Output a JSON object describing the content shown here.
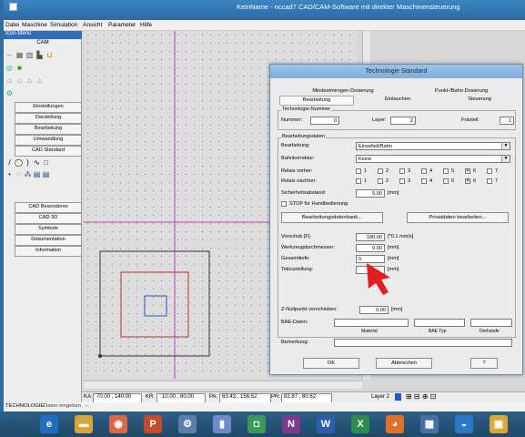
{
  "window": {
    "title": "KeinName - nccad7  CAD/CAM-Software mit direkter Maschinensteuerung"
  },
  "menu": [
    "Datei",
    "Maschine",
    "Simulation",
    "Ansicht",
    "Parameter",
    "Hilfe"
  ],
  "left": {
    "iconmenu_label": "Icon-Menü",
    "cam_label": "CAM",
    "buttons": [
      "Einstellungen",
      "Darstellung",
      "Bearbeitung",
      "Umwandlung",
      "CAD Standard"
    ],
    "buttons2": [
      "CAD Besonderes",
      "CAD 3D",
      "Symbole",
      "Dokumentation",
      "Information"
    ]
  },
  "status": {
    "ka_label": "KA:",
    "ka_value": "70.00 , 140.00",
    "kr_label": "KR:",
    "kr_value": "10.00 , 80.00",
    "pa_label": "PA:",
    "pa_value": "63.43 , 156.52",
    "pr_label": "PR:",
    "pr_value": "82.87 , 80.62",
    "layer": "Layer 2"
  },
  "cmdbar": {
    "mode": "TECHNOLOGIE",
    "prompt": "Daten eingeben"
  },
  "dialog": {
    "title": "Technologie Standard",
    "tabs_row1": [
      "Mindestmengen-Dosierung",
      "Punkt-/Bahn-Dosierung"
    ],
    "tabs_row2": [
      "Bearbeitung",
      "Eintauchen",
      "Steuerung"
    ],
    "tech_group": "Technologie-Nummer",
    "nummer_label": "Nummer:",
    "nummer_value": "0",
    "layer_label": "Layer:",
    "layer_value": "2",
    "fraeser_label": "Frästeil:",
    "fraeser_value": "1",
    "data_group": "Bearbeitungsdaten",
    "bearbeitung_label": "Bearbeitung:",
    "bearbeitung_value": "Einzelteil/Bahn",
    "bahnkorrektur_label": "Bahnkorrektur:",
    "bahnkorrektur_value": "Keine",
    "relais_vorher_label": "Relais vorher:",
    "relais_nachher_label": "Relais nachher:",
    "relais_options": [
      "1",
      "2",
      "3",
      "4",
      "5",
      "6",
      "7"
    ],
    "relais_checked": "6",
    "sicherheit_label": "Sicherheitsabstand:",
    "sicherheit_value": "5.00",
    "unit_mm": "[mm]",
    "stop_label": "STOP für Handbedienung",
    "btn_db": "Bearbeitungsdatenbank...",
    "btn_private": "Privatdaten bearbeiten...",
    "vorschub_label": "Vorschub [F]:",
    "vorschub_value": "180.00",
    "vorschub_unit": "[*0.1 mm/s]",
    "werkzeug_label": "Werkzeugdurchmesser:",
    "werkzeug_value": "0.00",
    "gesamttiefe_label": "Gesamttiefe:",
    "gesamttiefe_value": "0.",
    "teilzustellung_label": "Teilzustellung:",
    "teilzustellung_value": "",
    "znull_label": "Z-Nullpunkt verschieben:",
    "znull_value": "0.00",
    "bae_label": "BAE-Daten:",
    "bae_cols": [
      "Material",
      "BAE Typ",
      "Drehstufe"
    ],
    "bemerkung_label": "Bemerkung:",
    "ok": "OK",
    "cancel": "Abbrechen",
    "help": "?"
  },
  "colors": {
    "accent": "#2f6fb8",
    "cursor": "#e02020",
    "magenta_axis": "#c040c0"
  }
}
